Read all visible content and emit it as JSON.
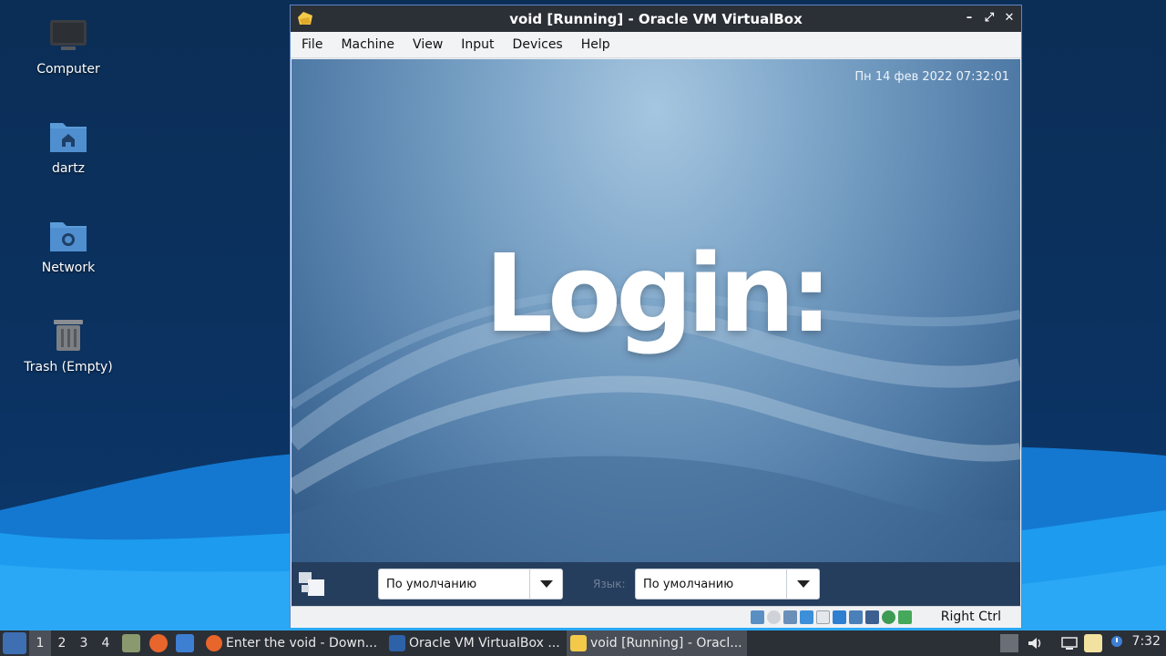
{
  "desktop": {
    "icons": [
      {
        "label": "Computer"
      },
      {
        "label": "dartz"
      },
      {
        "label": "Network"
      },
      {
        "label": "Trash (Empty)"
      }
    ]
  },
  "window": {
    "title": "void [Running] - Oracle VM VirtualBox",
    "controls": {
      "minimize": "–",
      "maximize": "⤢",
      "close": "✕"
    },
    "menu": [
      "File",
      "Machine",
      "View",
      "Input",
      "Devices",
      "Help"
    ],
    "guest": {
      "clock": "Пн 14 фев 2022 07:32:01",
      "heading": "Login:",
      "session_select": {
        "value": "По умолчанию"
      },
      "language_label": "Язык:",
      "language_select": {
        "value": "По умолчанию"
      }
    },
    "statusbar": {
      "host_key": "Right Ctrl"
    }
  },
  "taskbar": {
    "workspaces": [
      "1",
      "2",
      "3",
      "4"
    ],
    "active_workspace": "1",
    "tasks": [
      {
        "label": "Enter the void - Down..."
      },
      {
        "label": "Oracle VM VirtualBox ..."
      },
      {
        "label": "void [Running] - Oracl..."
      }
    ],
    "time": "7:32"
  },
  "colors": {
    "accent": "#5d86c6",
    "titlebar": "#2b2f36",
    "desktop_wave": "#1a8fe8"
  }
}
